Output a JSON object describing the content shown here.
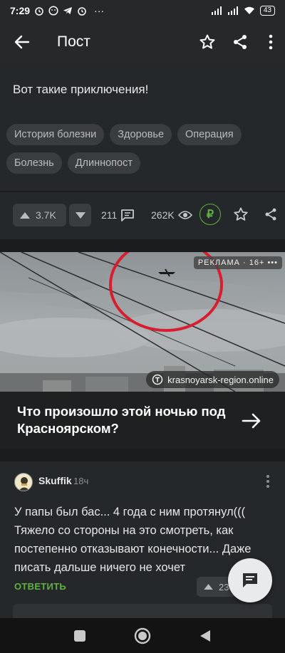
{
  "status_bar": {
    "time": "7:29",
    "overflow_dots": "···",
    "battery": "43"
  },
  "app_bar": {
    "title": "Пост"
  },
  "post": {
    "text": "Вот такие приключения!",
    "tags": [
      "История болезни",
      "Здоровье",
      "Операция",
      "Болезнь",
      "Длиннопост"
    ]
  },
  "actions": {
    "upvotes": "3.7K",
    "comments": "211",
    "views": "262K",
    "donate_symbol": "₽"
  },
  "ad": {
    "label": "РЕКЛАМА · 16+ •••",
    "source": "krasnoyarsk-region.online",
    "title": "Что произошло этой ночью под Красноярском?"
  },
  "comment": {
    "author": "Skuffik",
    "time": "18ч",
    "text": "У папы был бас... 4 года с ним протянул((( Тяжело со стороны на это смотреть, как постепенно отказывают конечности... Даже писать дальше ничего не хочет",
    "reply_label": "ОТВЕТИТЬ",
    "votes": "23"
  },
  "colors": {
    "background": "#1e1f20",
    "card": "#25282a",
    "tag_bg": "#3a3d40",
    "accent_green": "#5fb33c",
    "ad_circle": "#d81e2e"
  },
  "icons": [
    "back-arrow-icon",
    "star-icon",
    "share-icon",
    "more-vert-icon",
    "comment-icon",
    "eye-icon",
    "ruble-icon",
    "chat-icon",
    "square-nav-icon",
    "circle-nav-icon",
    "triangle-nav-icon"
  ]
}
